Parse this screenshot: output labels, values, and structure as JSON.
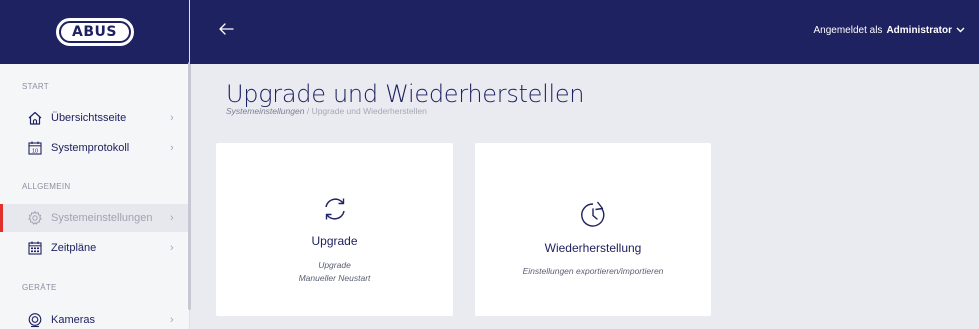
{
  "header": {
    "back_icon": "arrow-left-icon",
    "user_prefix": "Angemeldet als",
    "user_name": "Administrator",
    "dropdown_icon": "chevron-down-icon"
  },
  "logo": {
    "text": "ABUS"
  },
  "sidebar": {
    "sections": [
      {
        "title": "START"
      },
      {
        "title": "ALLGEMEIN"
      },
      {
        "title": "GERÄTE"
      }
    ],
    "items": [
      {
        "label": "Übersichtsseite",
        "icon": "home-icon"
      },
      {
        "label": "Systemprotokoll",
        "icon": "calendar-icon"
      },
      {
        "label": "Systemeinstellungen",
        "icon": "gear-icon",
        "active": true
      },
      {
        "label": "Zeitpläne",
        "icon": "schedule-calendar-icon"
      },
      {
        "label": "Kameras",
        "icon": "camera-icon"
      }
    ]
  },
  "main": {
    "title": "Upgrade und Wiederherstellen",
    "breadcrumb": [
      "Systemeinstellungen",
      "/",
      "Upgrade und Wiederherstellen"
    ],
    "cards": [
      {
        "title": "Upgrade",
        "subtitle_lines": [
          "Upgrade",
          "Manueller Neustart"
        ],
        "icon": "refresh-icon"
      },
      {
        "title": "Wiederherstellung",
        "subtitle_lines": [
          "Einstellungen exportieren/importieren"
        ],
        "icon": "history-icon"
      }
    ]
  },
  "colors": {
    "brand_navy": "#1f2260",
    "active_marker": "#e0312b",
    "background": "#e9ebf1"
  }
}
